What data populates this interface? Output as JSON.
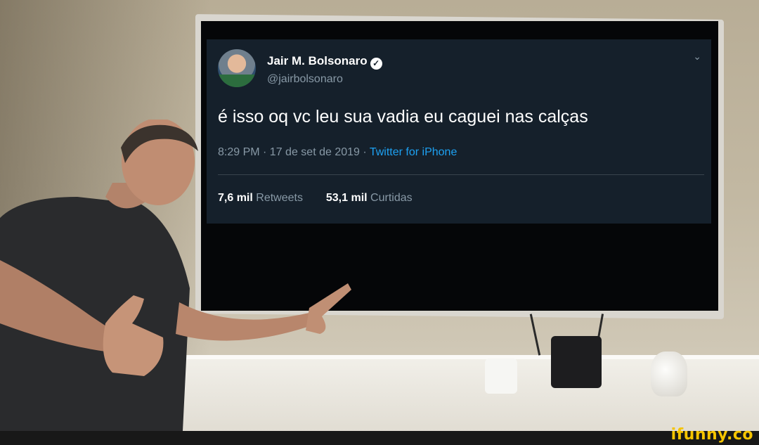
{
  "tweet": {
    "name": "Jair M. Bolsonaro",
    "handle": "@jairbolsonaro",
    "text": "é isso oq vc leu sua vadia eu caguei nas calças",
    "time": "8:29 PM · 17 de set de 2019 ·",
    "source": "Twitter for iPhone",
    "retweets_count": "7,6 mil",
    "retweets_label": "Retweets",
    "likes_count": "53,1 mil",
    "likes_label": "Curtidas",
    "verified_icon": "verified-badge-icon",
    "menu_icon": "chevron-down-icon"
  },
  "watermark": "ifunny.co",
  "colors": {
    "tweet_bg": "#15202b",
    "link": "#1da1f2",
    "muted": "#8899a6",
    "watermark": "#f5c400"
  }
}
